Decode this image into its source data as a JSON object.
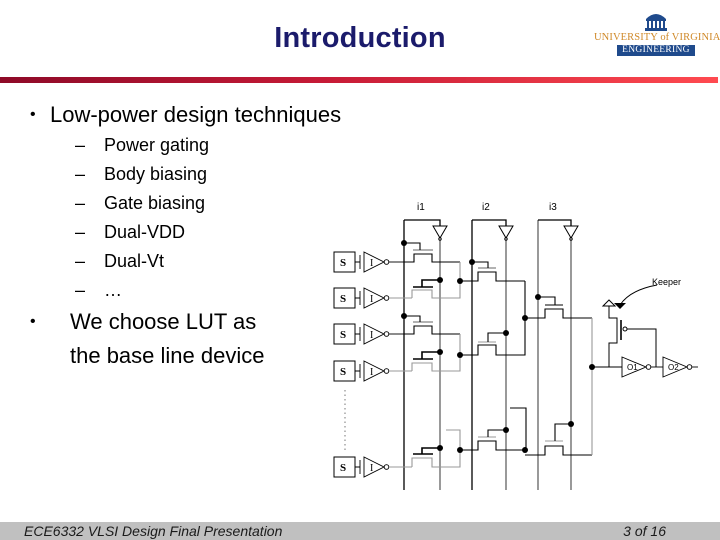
{
  "slide": {
    "title": "Introduction",
    "logo": {
      "university": "UNIVERSITY of VIRGINIA",
      "school": "ENGINEERING",
      "icon": "rotunda-icon",
      "colors": {
        "gold": "#d08a2a",
        "blue": "#1f4a8c"
      }
    },
    "rule_colors": {
      "start": "#8e0a28",
      "end": "#ff4a50"
    },
    "bullets": [
      {
        "text": "Low-power design techniques",
        "sub": [
          "Power gating",
          "Body biasing",
          "Gate biasing",
          "Dual-VDD",
          "Dual-Vt",
          "…"
        ]
      },
      {
        "text_lines": [
          "We choose LUT as",
          "the base line device"
        ]
      }
    ],
    "sub_marker": "–",
    "bullet_marker": "•"
  },
  "circuit": {
    "input_labels": [
      "i1",
      "i2",
      "i3"
    ],
    "sram_cell_label": "S",
    "inverter_label": "I",
    "keeper_label": "Keeper",
    "output_inverters": [
      "O1",
      "O2"
    ]
  },
  "footer": {
    "left": "ECE6332 VLSI Design Final Presentation",
    "right": "3 of  16"
  }
}
